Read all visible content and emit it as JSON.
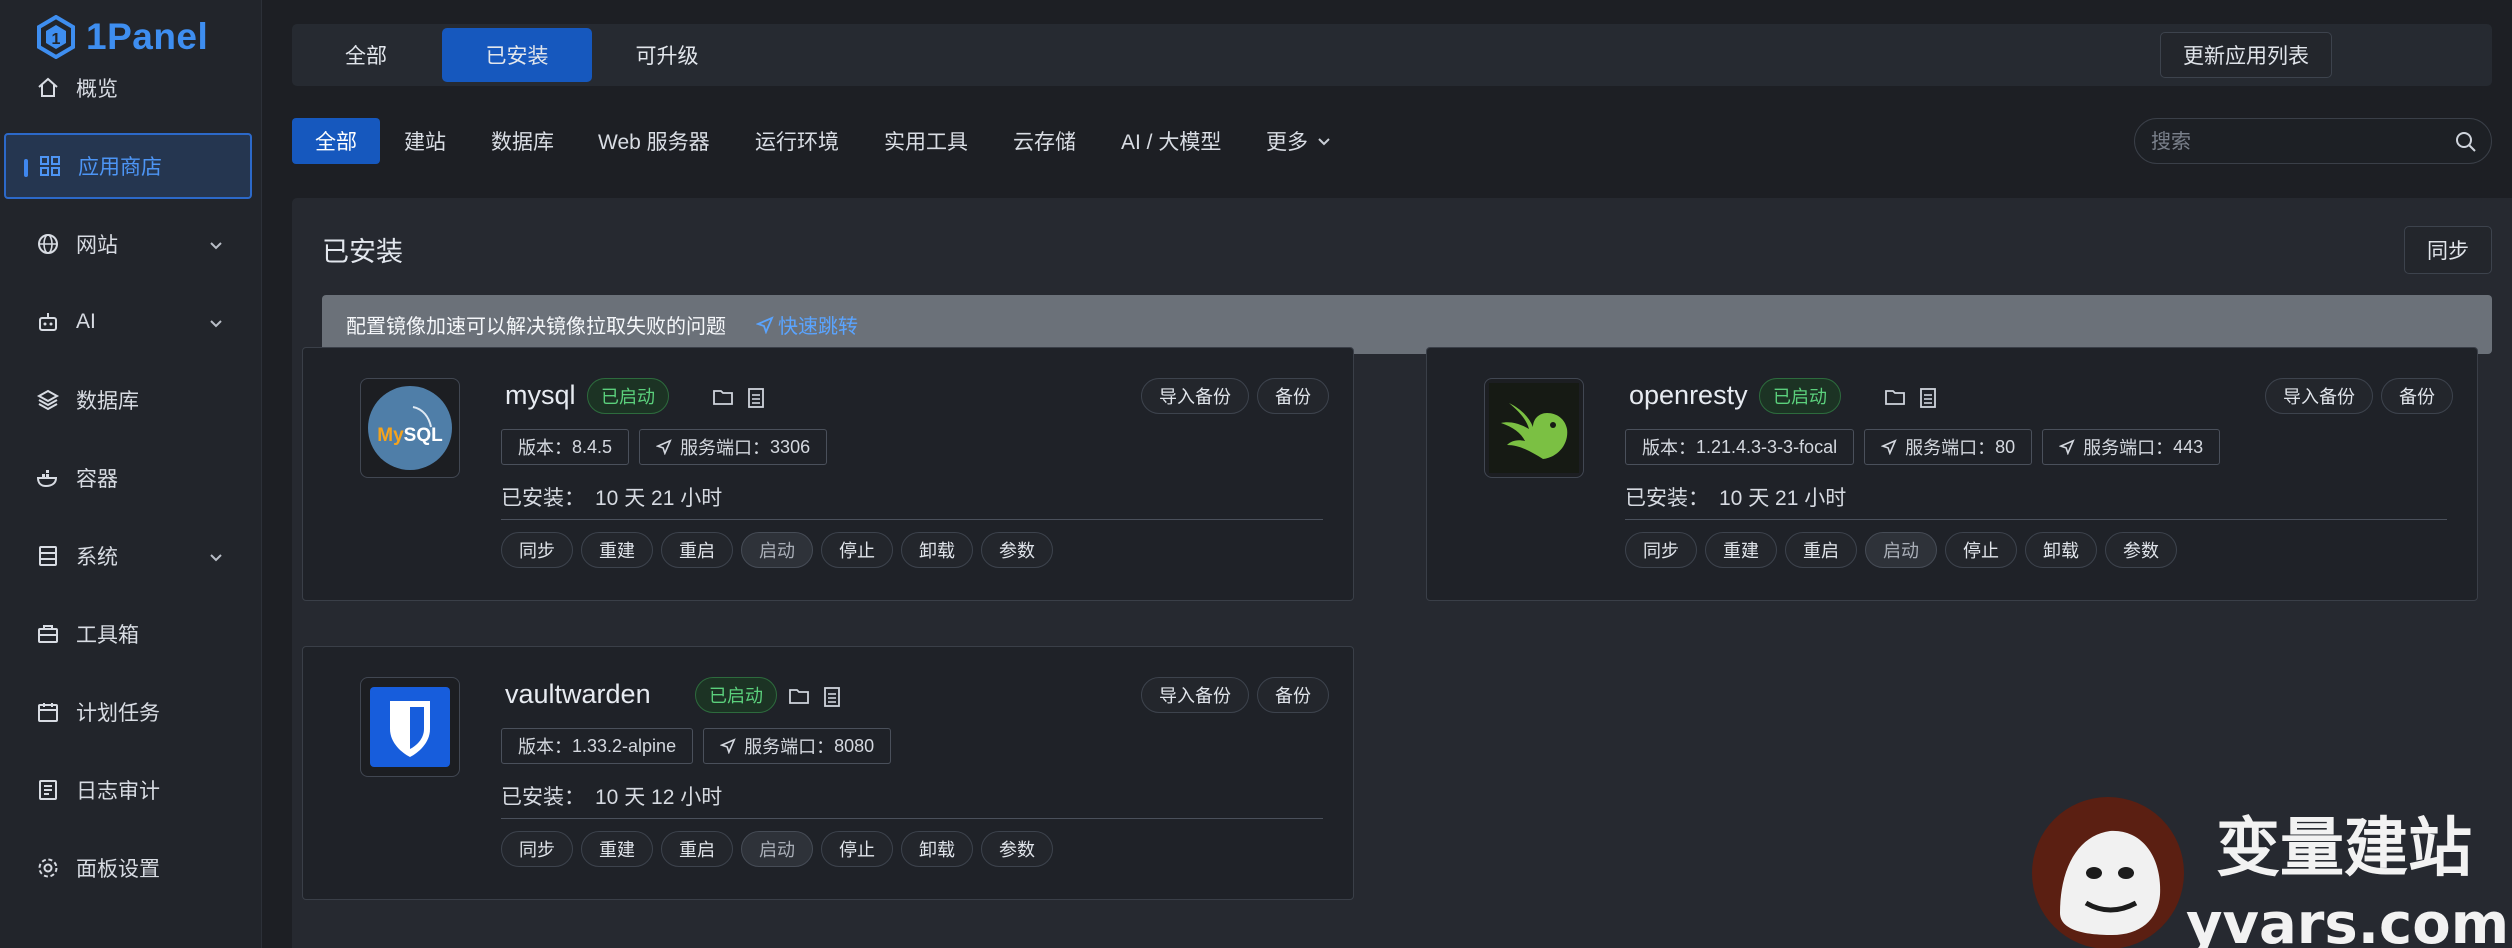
{
  "app": {
    "logo_text": "1Panel"
  },
  "sidebar": {
    "items": [
      {
        "label": "概览",
        "icon": "home-icon",
        "has_children": false,
        "active": false
      },
      {
        "label": "应用商店",
        "icon": "grid-icon",
        "has_children": false,
        "active": true
      },
      {
        "label": "网站",
        "icon": "globe-icon",
        "has_children": true,
        "active": false
      },
      {
        "label": "AI",
        "icon": "robot-icon",
        "has_children": true,
        "active": false
      },
      {
        "label": "数据库",
        "icon": "layers-icon",
        "has_children": false,
        "active": false
      },
      {
        "label": "容器",
        "icon": "docker-icon",
        "has_children": false,
        "active": false
      },
      {
        "label": "系统",
        "icon": "server-icon",
        "has_children": true,
        "active": false
      },
      {
        "label": "工具箱",
        "icon": "toolbox-icon",
        "has_children": false,
        "active": false
      },
      {
        "label": "计划任务",
        "icon": "calendar-icon",
        "has_children": false,
        "active": false
      },
      {
        "label": "日志审计",
        "icon": "log-icon",
        "has_children": false,
        "active": false
      },
      {
        "label": "面板设置",
        "icon": "gear-icon",
        "has_children": false,
        "active": false
      }
    ]
  },
  "tabs": [
    {
      "label": "全部",
      "active": false
    },
    {
      "label": "已安装",
      "active": true
    },
    {
      "label": "可升级",
      "active": false
    }
  ],
  "update_list_button": "更新应用列表",
  "categories": [
    {
      "label": "全部",
      "active": true
    },
    {
      "label": "建站",
      "active": false
    },
    {
      "label": "数据库",
      "active": false
    },
    {
      "label": "Web 服务器",
      "active": false
    },
    {
      "label": "运行环境",
      "active": false
    },
    {
      "label": "实用工具",
      "active": false
    },
    {
      "label": "云存储",
      "active": false
    },
    {
      "label": "AI / 大模型",
      "active": false
    },
    {
      "label": "更多",
      "active": false,
      "dropdown": true
    }
  ],
  "search": {
    "placeholder": "搜索",
    "value": ""
  },
  "section": {
    "title": "已安装",
    "sync_button": "同步"
  },
  "notice": {
    "text": "配置镜像加速可以解决镜像拉取失败的问题",
    "link": "快速跳转"
  },
  "labels": {
    "status": "已启动",
    "import_backup": "导入备份",
    "backup": "备份",
    "version_prefix": "版本：",
    "port_prefix": "服务端口：",
    "installed_prefix": "已安装：",
    "actions": [
      "同步",
      "重建",
      "重启",
      "启动",
      "停止",
      "卸载",
      "参数"
    ],
    "disabled_action": "启动"
  },
  "apps": [
    {
      "name": "mysql",
      "icon": "mysql-logo",
      "version": "8.4.5",
      "ports": [
        "3306"
      ],
      "installed": "10 天 21 小时"
    },
    {
      "name": "openresty",
      "icon": "openresty-logo",
      "version": "1.21.4.3-3-3-focal",
      "ports": [
        "80",
        "443"
      ],
      "installed": "10 天 21 小时"
    },
    {
      "name": "vaultwarden",
      "icon": "vaultwarden-logo",
      "version": "1.33.2-alpine",
      "ports": [
        "8080"
      ],
      "installed": "10 天 12 小时"
    }
  ],
  "colors": {
    "accent": "#1658be",
    "status_green": "#5bd07c",
    "link": "#5aa4ff"
  },
  "watermark": {
    "brand": "变量建站",
    "domain": "yvars.com"
  }
}
